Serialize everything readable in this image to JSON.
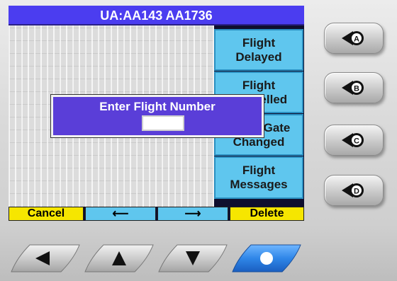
{
  "title": "UA:AA143  AA1736",
  "menu": [
    {
      "line1": "Flight",
      "line2": "Delayed"
    },
    {
      "line1": "Flight",
      "line2": "Cancelled"
    },
    {
      "line1": "Flight Gate",
      "line2": "Changed"
    },
    {
      "line1": "Flight",
      "line2": "Messages"
    }
  ],
  "softkeys": {
    "cancel": "Cancel",
    "left": "⟵",
    "right": "⟶",
    "delete": "Delete"
  },
  "dialog": {
    "title": "Enter Flight Number",
    "value": ""
  },
  "side_buttons": [
    "A",
    "B",
    "C",
    "D"
  ],
  "nav_buttons": {
    "left_icon": "left-arrow-icon",
    "up_icon": "up-arrow-icon",
    "down_icon": "down-arrow-icon",
    "select_icon": "select-dot-icon"
  },
  "colors": {
    "title_bar": "#4b3df0",
    "menu_button": "#5fc6ee",
    "softkey_yellow": "#f6e600",
    "dialog": "#5a3ed8",
    "select_button": "#2f86e8"
  }
}
